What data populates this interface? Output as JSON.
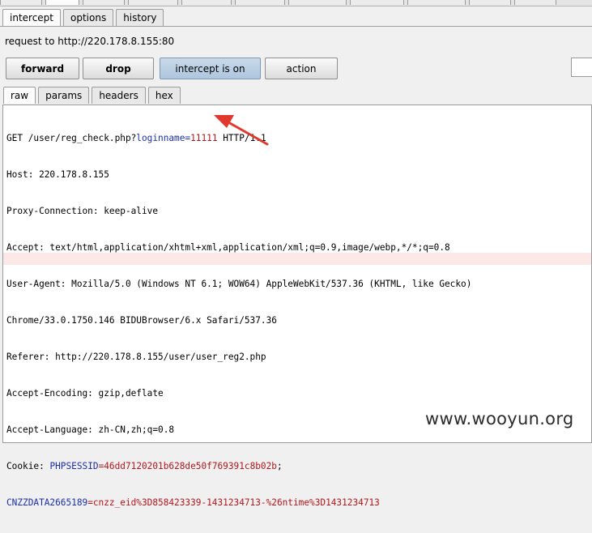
{
  "proxy_tabs": [
    {
      "label": "intercept",
      "active": true
    },
    {
      "label": "options",
      "active": false
    },
    {
      "label": "history",
      "active": false
    }
  ],
  "request_label": "request to http://220.178.8.155:80",
  "buttons": {
    "forward": "forward",
    "drop": "drop",
    "intercept": "intercept is on",
    "action": "action"
  },
  "view_tabs": [
    {
      "label": "raw",
      "active": true
    },
    {
      "label": "params",
      "active": false
    },
    {
      "label": "headers",
      "active": false
    },
    {
      "label": "hex",
      "active": false
    }
  ],
  "request": {
    "line1": {
      "pre": "GET /user/reg_check.php?",
      "param": "loginname",
      "eq": "=",
      "value": "11111",
      "post": " HTTP/1.1"
    },
    "host": "Host: 220.178.8.155",
    "proxy_connection": "Proxy-Connection: keep-alive",
    "accept": "Accept: text/html,application/xhtml+xml,application/xml;q=0.9,image/webp,*/*;q=0.8",
    "user_agent_1": "User-Agent: Mozilla/5.0 (Windows NT 6.1; WOW64) AppleWebKit/537.36 (KHTML, like Gecko)",
    "user_agent_2": "Chrome/33.0.1750.146 BIDUBrowser/6.x Safari/537.36",
    "referer": "Referer: http://220.178.8.155/user/user_reg2.php",
    "accept_encoding": "Accept-Encoding: gzip,deflate",
    "accept_language": "Accept-Language: zh-CN,zh;q=0.8",
    "cookie": {
      "prefix": "Cookie: ",
      "name1": "PHPSESSID",
      "value1": "=46dd7120201b628de50f769391c8b02b",
      "suffix1": ";"
    },
    "cookie2": {
      "name2": "CNZZDATA2665189",
      "value2": "=cnzz_eid%3D858423339-1431234713-%26ntime%3D1431234713"
    }
  },
  "watermark": "www.wooyun.org",
  "colors": {
    "param_blue": "#1b2fa8",
    "value_red": "#b0181c",
    "arrow_red": "#e0382c",
    "intercept_on": "#bcd0e4"
  }
}
